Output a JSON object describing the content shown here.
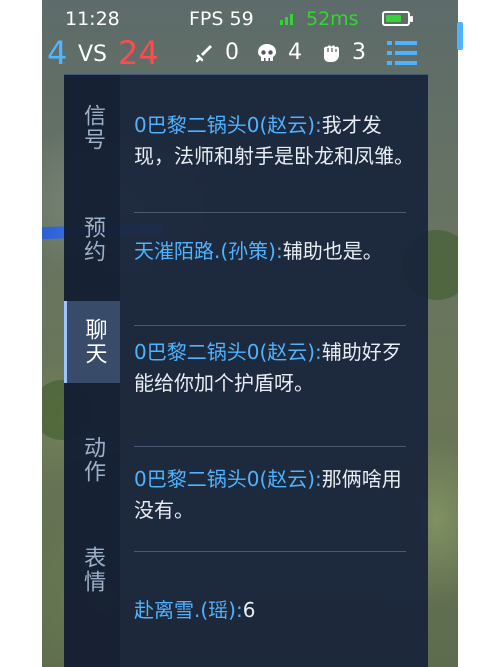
{
  "status": {
    "time": "11:28",
    "fps": "FPS 59",
    "ping": "52ms",
    "battery_level": 0.75
  },
  "score": {
    "left": "4",
    "vs": "VS",
    "right": "24",
    "kills": "0",
    "deaths": "4",
    "assists": "3"
  },
  "tabs": [
    {
      "label": "信号"
    },
    {
      "label": "预约"
    },
    {
      "label": "聊天"
    },
    {
      "label": "动作"
    },
    {
      "label": "表情"
    }
  ],
  "active_tab": 2,
  "messages": [
    {
      "sender": "0巴黎二锅头0(赵云):",
      "text": "我才发现，法师和射手是卧龙和凤雏。"
    },
    {
      "sender": "天漼陌路.(孙策):",
      "text": "辅助也是。"
    },
    {
      "sender": "0巴黎二锅头0(赵云):",
      "text": "辅助好歹能给你加个护盾呀。"
    },
    {
      "sender": "0巴黎二锅头0(赵云):",
      "text": "那俩啥用没有。"
    },
    {
      "sender": "赴离雪.(瑶):",
      "text": "6"
    }
  ],
  "colors": {
    "sender": "#4fb2ff",
    "message": "#e8edf4",
    "team_blue": "#4fb6ff",
    "team_red": "#ff4b4b",
    "signal": "#35d435"
  }
}
